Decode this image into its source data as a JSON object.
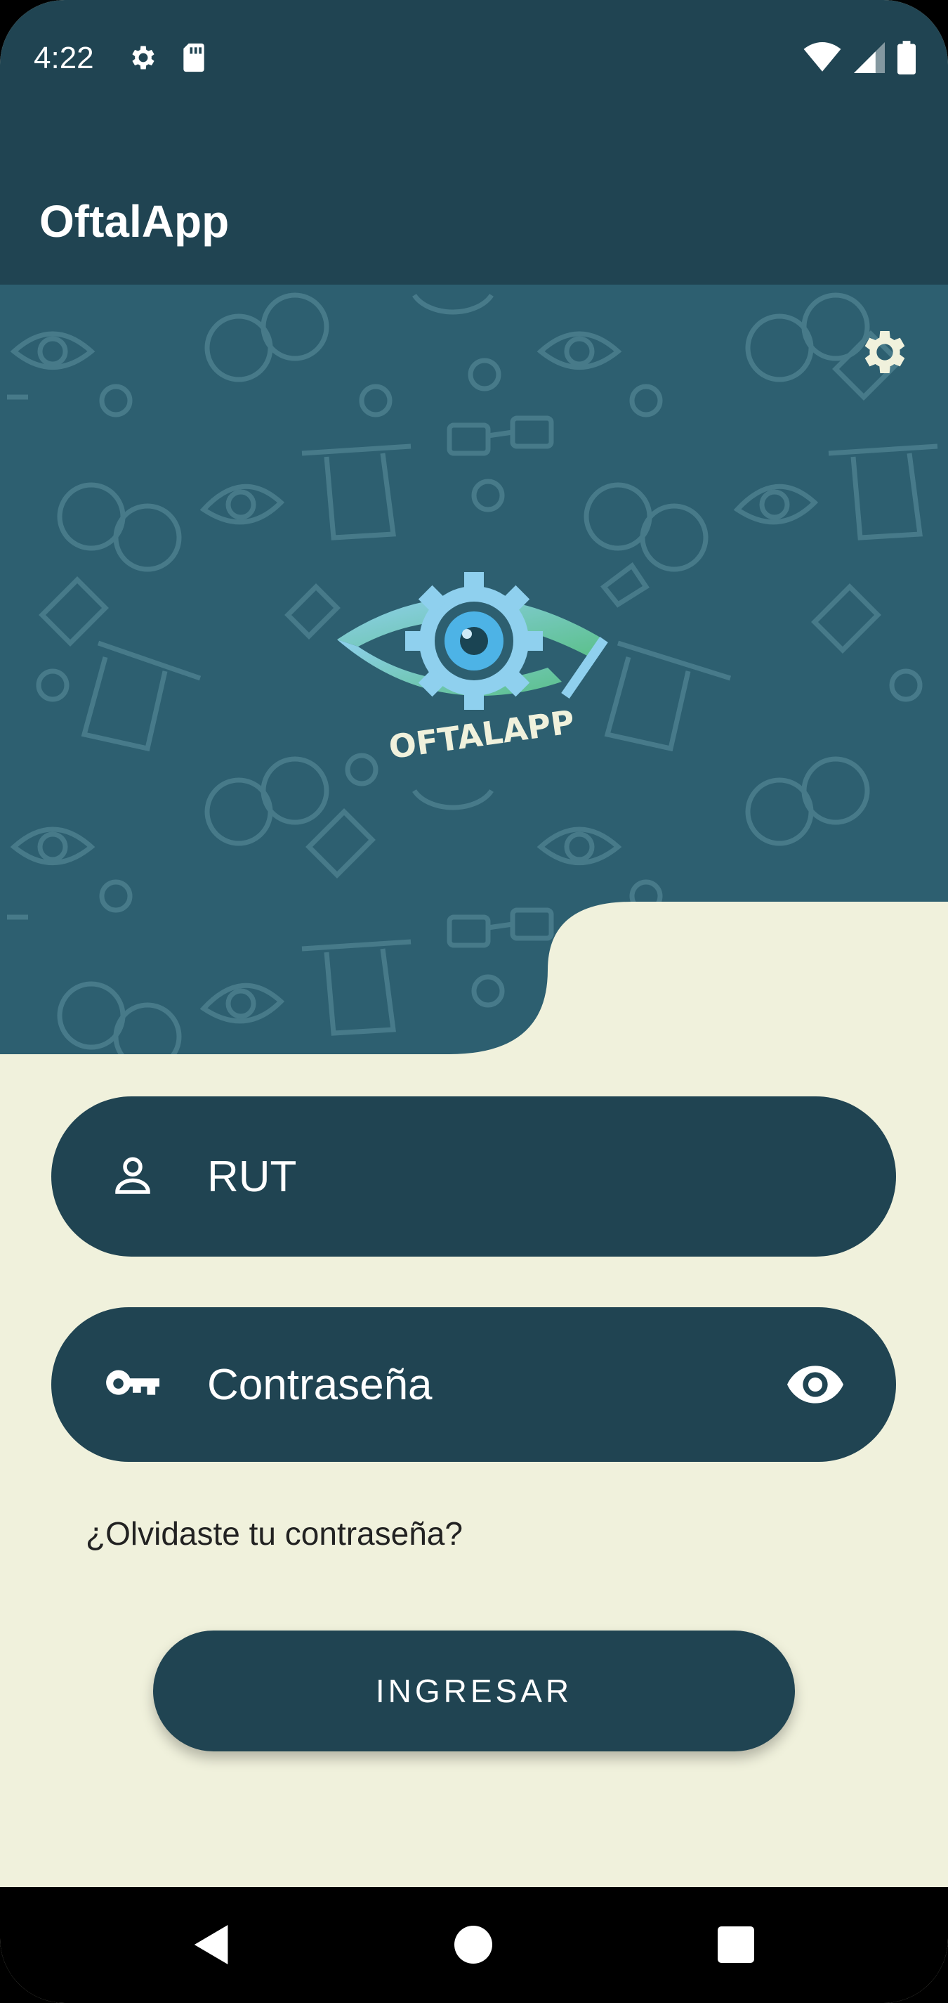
{
  "status_bar": {
    "time": "4:22",
    "left_icons": [
      "gear-icon",
      "sd-card-icon"
    ],
    "right_icons": [
      "wifi-icon",
      "cell-signal-icon",
      "battery-icon"
    ]
  },
  "app_bar": {
    "title": "OftalApp"
  },
  "hero": {
    "settings_icon": "gear-icon",
    "logo_text": "OFTALAPP"
  },
  "login_form": {
    "rut_placeholder": "RUT",
    "rut_value": "",
    "rut_icon": "person-icon",
    "password_placeholder": "Contraseña",
    "password_value": "",
    "password_icon": "key-icon",
    "password_toggle_icon": "eye-icon",
    "forgot_password": "¿Olvidaste tu contraseña?",
    "submit_label": "INGRESAR"
  },
  "nav_bar": {
    "buttons": [
      "back-icon",
      "home-icon",
      "recents-icon"
    ]
  },
  "colors": {
    "primary": "#204452",
    "hero_bg": "#2d5f70",
    "surface": "#f0f1dc",
    "accent_logo": "#59b8e6"
  }
}
